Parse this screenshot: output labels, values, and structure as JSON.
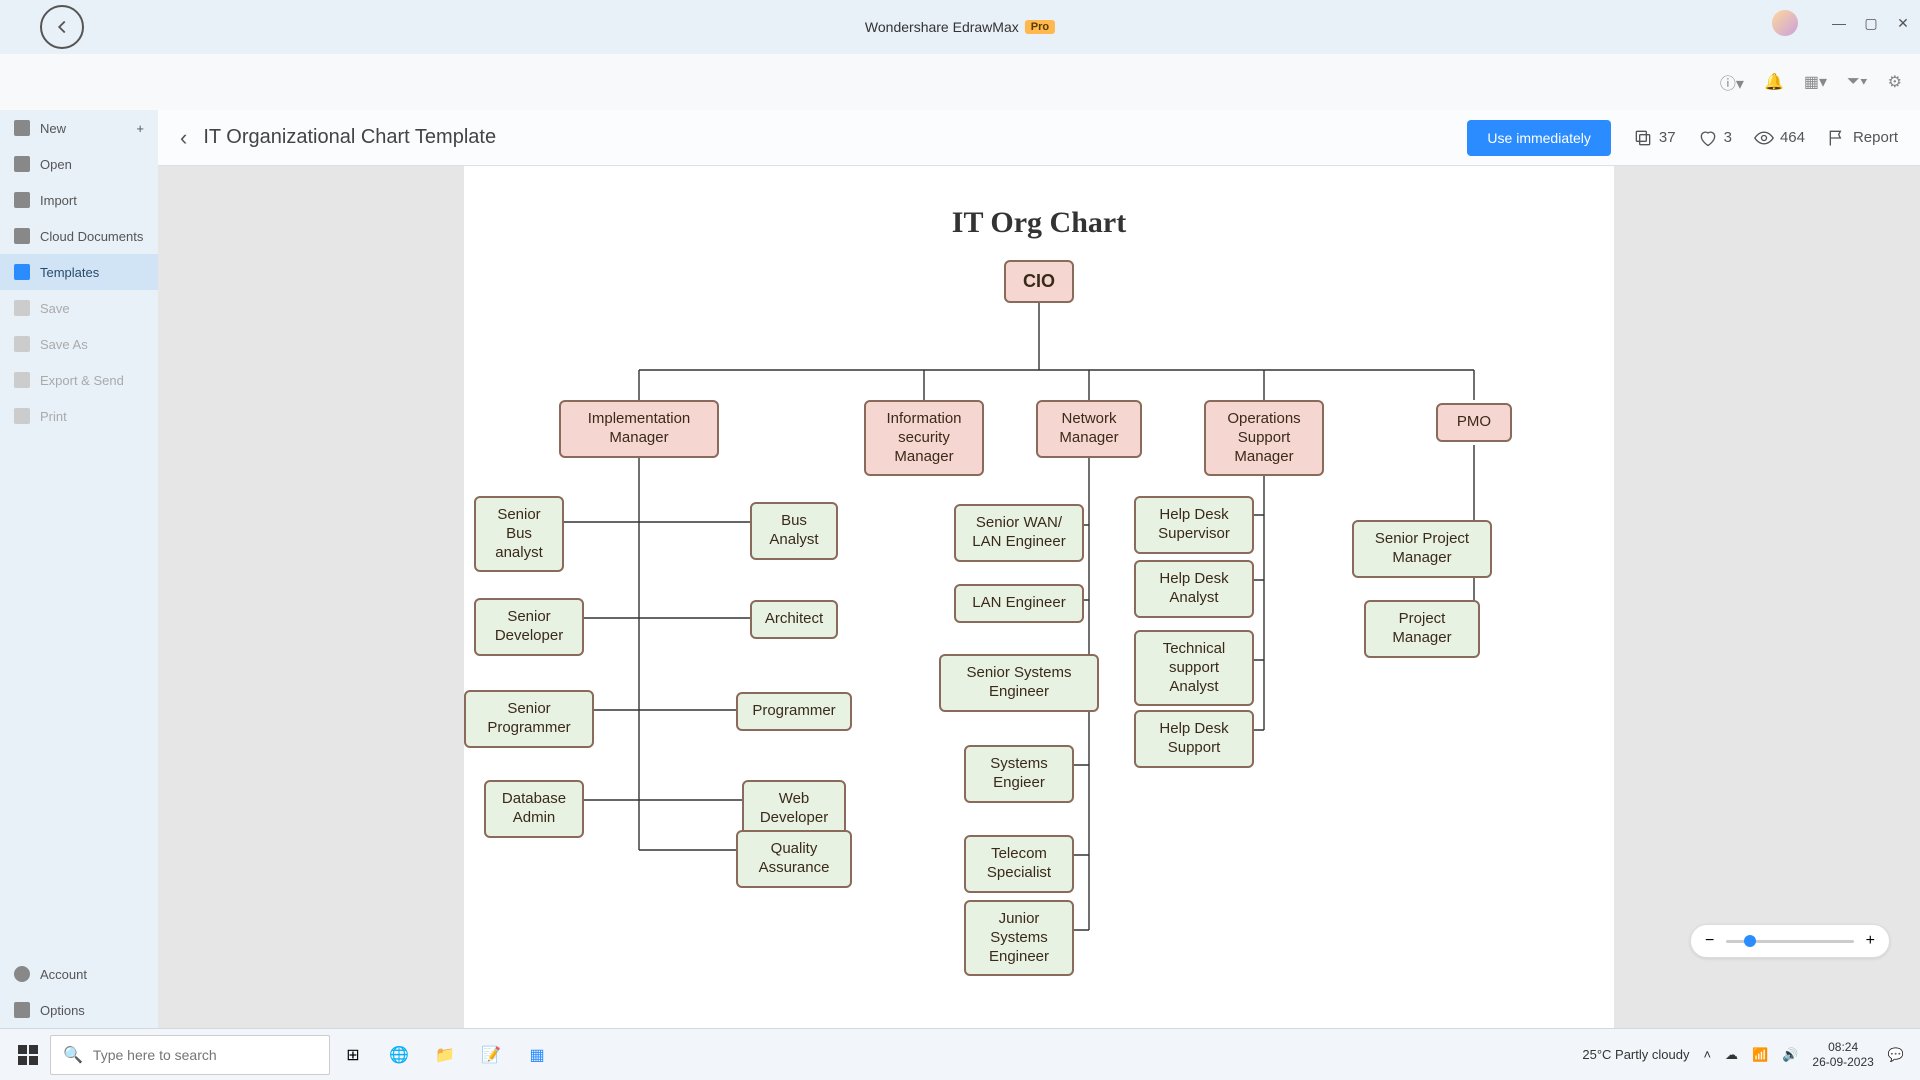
{
  "app": {
    "title": "Wondershare EdrawMax",
    "pro": "Pro"
  },
  "sidebar": {
    "new": "New",
    "open": "Open",
    "import": "Import",
    "cloud": "Cloud Documents",
    "templates": "Templates",
    "save": "Save",
    "saveas": "Save As",
    "export": "Export & Send",
    "print": "Print",
    "account": "Account",
    "options": "Options"
  },
  "header": {
    "title": "IT Organizational Chart Template",
    "use": "Use immediately",
    "copies": "37",
    "likes": "3",
    "views": "464",
    "report": "Report"
  },
  "chart": {
    "title": "IT Org Chart",
    "cio": "CIO",
    "mgr": {
      "impl": "Implementation Manager",
      "infosec": "Information security Manager",
      "network": "Network Manager",
      "ops": "Operations Support Manager",
      "pmo": "PMO"
    },
    "leaf": {
      "sba": "Senior Bus analyst",
      "ba": "Bus Analyst",
      "sdev": "Senior Developer",
      "arch": "Architect",
      "sprog": "Senior Programmer",
      "prog": "Programmer",
      "dba": "Database Admin",
      "web": "Web Developer",
      "qa": "Quality Assurance",
      "swan": "Senior WAN/ LAN Engineer",
      "lan": "LAN Engineer",
      "ssys": "Senior Systems Engineer",
      "syse": "Systems Engieer",
      "tel": "Telecom Specialist",
      "jsys": "Junior Systems Engineer",
      "hds": "Help Desk Supervisor",
      "hda": "Help Desk Analyst",
      "tsa": "Technical support Analyst",
      "hdsup": "Help Desk Support",
      "spm": "Senior Project Manager",
      "pm": "Project Manager"
    }
  },
  "taskbar": {
    "search_placeholder": "Type here to search",
    "weather": "25°C  Partly cloudy",
    "time": "08:24",
    "date": "26-09-2023"
  }
}
